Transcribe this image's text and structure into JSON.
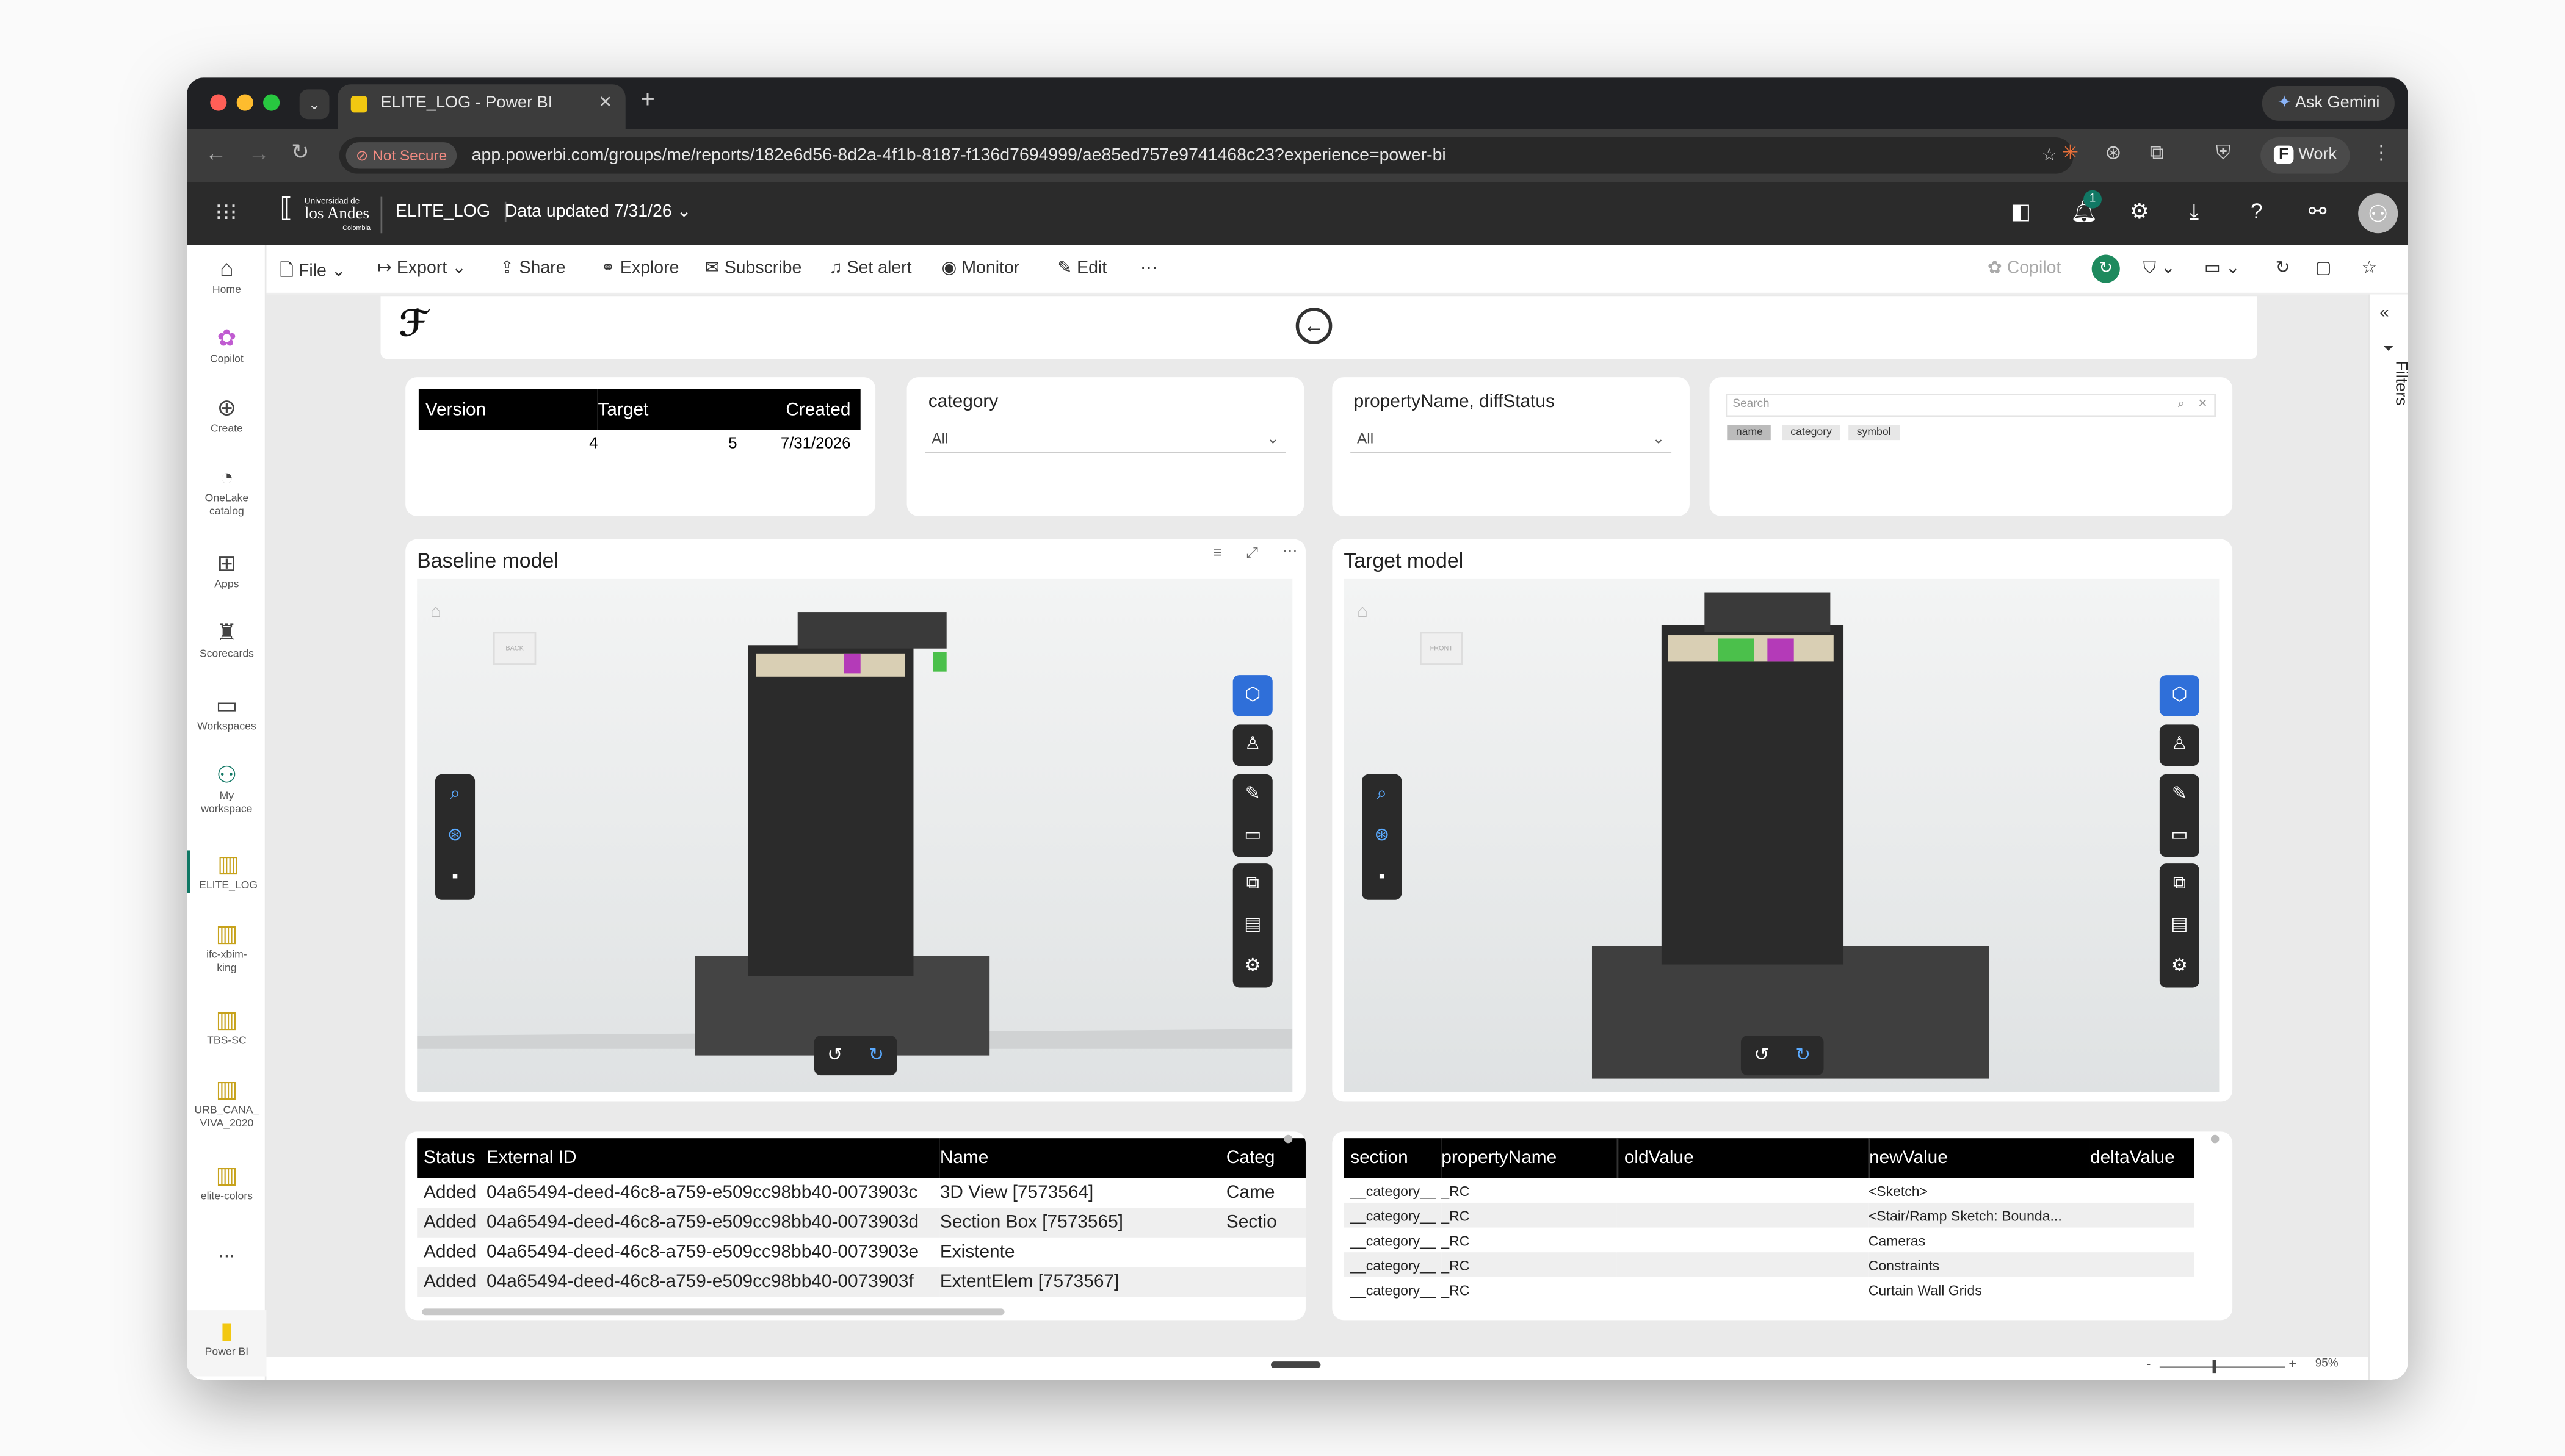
{
  "browser": {
    "tab_title": "ELITE_LOG - Power BI",
    "not_secure": "Not Secure",
    "url": "app.powerbi.com/groups/me/reports/182e6d56-8d2a-4f1b-8187-f136d7694999/ae85ed757e9741468c23?experience=power-bi",
    "ask_gemini": "Ask Gemini",
    "profile": "Work"
  },
  "header": {
    "logo_line1": "Universidad de",
    "logo_line2": "los Andes",
    "logo_line3": "Colombia",
    "report_name": "ELITE_LOG",
    "data_updated": "Data updated 7/31/26",
    "notif_count": "1"
  },
  "leftnav": [
    {
      "label": "Home",
      "icon": "⌂"
    },
    {
      "label": "Copilot",
      "icon": "✿"
    },
    {
      "label": "Create",
      "icon": "⊕"
    },
    {
      "label": "OneLake catalog",
      "icon": "◔"
    },
    {
      "label": "Apps",
      "icon": "⊞"
    },
    {
      "label": "Scorecards",
      "icon": "♜"
    },
    {
      "label": "Workspaces",
      "icon": "▭"
    },
    {
      "label": "My workspace",
      "icon": "⚇"
    },
    {
      "label": "ELITE_LOG",
      "icon": "▥"
    },
    {
      "label": "ifc-xbim-king",
      "icon": "▥"
    },
    {
      "label": "TBS-SC",
      "icon": "▥"
    },
    {
      "label": "URB_CANA_ VIVA_2020",
      "icon": "▥"
    },
    {
      "label": "elite-colors",
      "icon": "▥"
    },
    {
      "label": "...",
      "icon": ""
    },
    {
      "label": "Power BI",
      "icon": "▮"
    }
  ],
  "toolbar": {
    "file": "File",
    "export": "Export",
    "share": "Share",
    "explore": "Explore",
    "subscribe": "Subscribe",
    "set_alert": "Set alert",
    "monitor": "Monitor",
    "edit": "Edit",
    "more": "···",
    "copilot": "Copilot"
  },
  "version_table": {
    "headers": [
      "Version",
      "Target",
      "Created"
    ],
    "row": [
      "4",
      "5",
      "7/31/2026"
    ]
  },
  "slicer1": {
    "title": "category",
    "value": "All"
  },
  "slicer2": {
    "title": "propertyName, diffStatus",
    "value": "All"
  },
  "search_visual": {
    "placeholder": "Search",
    "chips": [
      "name",
      "category",
      "symbol"
    ]
  },
  "baseline": {
    "title": "Baseline model",
    "cube": "BACK"
  },
  "target": {
    "title": "Target model",
    "cube": "FRONT"
  },
  "changes_table": {
    "headers": [
      "Status",
      "External ID",
      "Name",
      "Categ"
    ],
    "rows": [
      [
        "Added",
        "04a65494-deed-46c8-a759-e509cc98bb40-0073903c",
        "3D View [7573564]",
        "Came"
      ],
      [
        "Added",
        "04a65494-deed-46c8-a759-e509cc98bb40-0073903d",
        "Section Box [7573565]",
        "Sectio"
      ],
      [
        "Added",
        "04a65494-deed-46c8-a759-e509cc98bb40-0073903e",
        "Existente",
        ""
      ],
      [
        "Added",
        "04a65494-deed-46c8-a759-e509cc98bb40-0073903f",
        "ExtentElem [7573567]",
        ""
      ]
    ]
  },
  "props_table": {
    "headers": [
      "section",
      "propertyName",
      "oldValue",
      "newValue",
      "deltaValue"
    ],
    "rows": [
      [
        "__category__",
        "_RC",
        "",
        "<Sketch>",
        ""
      ],
      [
        "__category__",
        "_RC",
        "",
        "<Stair/Ramp Sketch: Bounda...",
        ""
      ],
      [
        "__category__",
        "_RC",
        "",
        "Cameras",
        ""
      ],
      [
        "__category__",
        "_RC",
        "",
        "Constraints",
        ""
      ],
      [
        "__category__",
        "_RC",
        "",
        "Curtain Wall Grids",
        ""
      ]
    ]
  },
  "filters_label": "Filters",
  "zoom": {
    "minus": "-",
    "plus": "+",
    "value": "95%"
  }
}
